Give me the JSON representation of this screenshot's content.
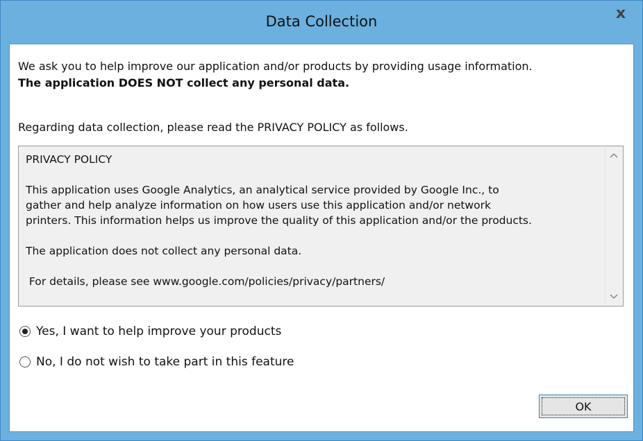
{
  "window": {
    "title": "Data Collection",
    "close_glyph": "x"
  },
  "intro": {
    "line1": "We ask you to help improve our application and/or products by providing usage information.",
    "line2": "The application DOES NOT collect any personal data."
  },
  "regarding": "Regarding data collection, please read the PRIVACY POLICY as follows.",
  "policy": {
    "heading": "PRIVACY POLICY",
    "p1_line1": "This application uses Google Analytics, an analytical service provided by Google Inc., to",
    "p1_line2": "gather and help analyze information on how users use this application and/or network",
    "p1_line3": "printers. This information helps us improve the quality of this application and/or the products.",
    "p2": "The application does not collect any personal data.",
    "p3": " For details, please see www.google.com/policies/privacy/partners/"
  },
  "options": {
    "yes_label": "Yes, I want to help improve your products",
    "no_label": "No, I do not wish to take part in this feature",
    "selected": "yes"
  },
  "buttons": {
    "ok_label": "OK"
  },
  "icons": {
    "close": "close-icon",
    "scroll_up": "chevron-up-icon",
    "scroll_down": "chevron-down-icon"
  },
  "colors": {
    "frame": "#6bb0df",
    "client": "#ffffff",
    "policy_bg": "#f0f0f0"
  }
}
